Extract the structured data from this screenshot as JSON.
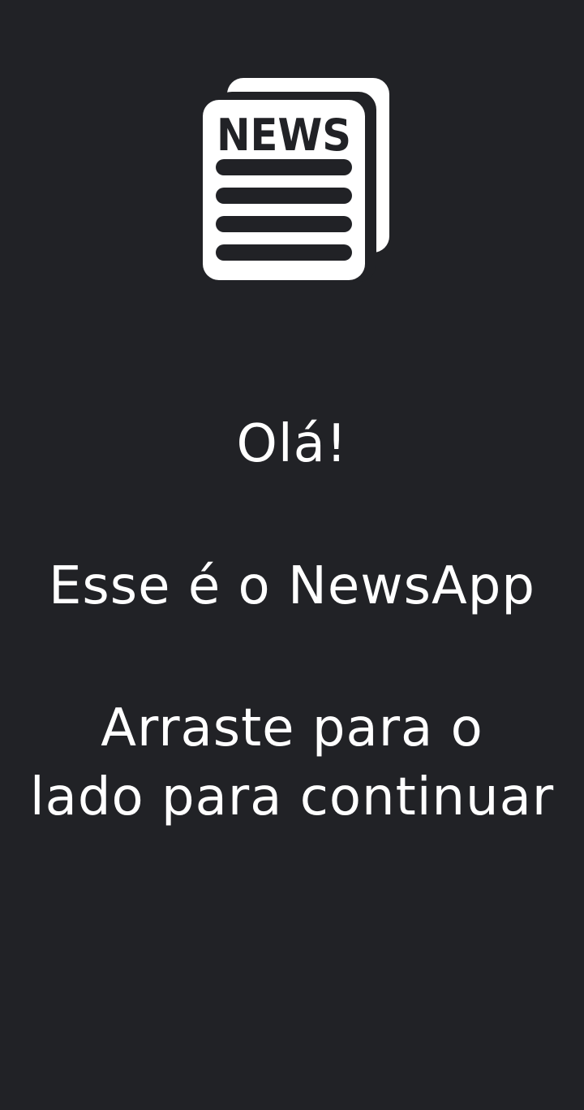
{
  "logo": {
    "word": "NEWS",
    "icon": "newspaper-icon"
  },
  "welcome": {
    "greeting": "Olá!",
    "intro": "Esse é o NewsApp",
    "instruction_line1": "Arraste para o",
    "instruction_line2": "lado para continuar"
  },
  "colors": {
    "background": "#212226",
    "foreground": "#ffffff"
  }
}
